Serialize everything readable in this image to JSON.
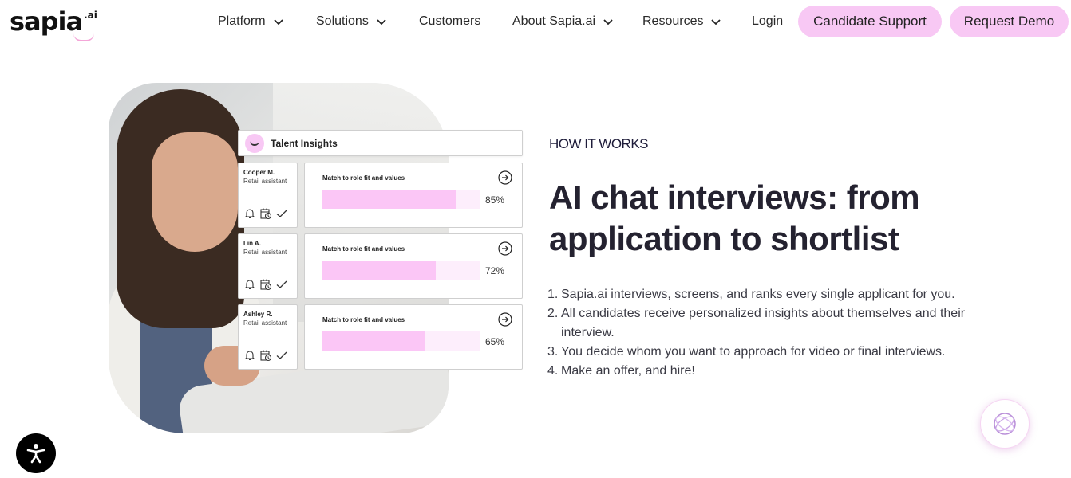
{
  "brand": {
    "name": "sapia",
    "suffix": ".ai",
    "accent": "#F8C8F4"
  },
  "nav": {
    "items": [
      {
        "label": "Platform",
        "dropdown": true
      },
      {
        "label": "Solutions",
        "dropdown": true
      },
      {
        "label": "Customers",
        "dropdown": false
      },
      {
        "label": "About Sapia.ai",
        "dropdown": true
      },
      {
        "label": "Resources",
        "dropdown": true
      },
      {
        "label": "Login",
        "dropdown": false
      }
    ],
    "candidate_support": "Candidate Support",
    "request_demo": "Request Demo"
  },
  "insights": {
    "title": "Talent Insights",
    "match_label": "Match to role fit and values",
    "candidates": [
      {
        "name": "Cooper M.",
        "role": "Retail assistant",
        "match": "85%",
        "match_value": 0.85
      },
      {
        "name": "Lin A.",
        "role": "Retail assistant",
        "match": "72%",
        "match_value": 0.72
      },
      {
        "name": "Ashley R.",
        "role": "Retail assistant",
        "match": "65%",
        "match_value": 0.65
      }
    ]
  },
  "section": {
    "eyebrow": "HOW IT WORKS",
    "headline": "AI chat interviews: from application to shortlist",
    "steps": [
      {
        "num": "1.",
        "text": "Sapia.ai interviews, screens, and ranks every single applicant for you."
      },
      {
        "num": "2.",
        "text": "All candidates receive personalized insights about themselves and their interview."
      },
      {
        "num": "3.",
        "text": "You decide whom you want to approach for video or final interviews."
      },
      {
        "num": "4.",
        "text": "Make an offer, and hire!"
      }
    ]
  },
  "icons": {
    "accessibility": "accessibility-icon",
    "chat": "chat-globe-icon",
    "bell": "bell-icon",
    "calendar": "calendar-clock-icon",
    "check": "check-icon",
    "arrow": "arrow-right-circle-icon"
  }
}
